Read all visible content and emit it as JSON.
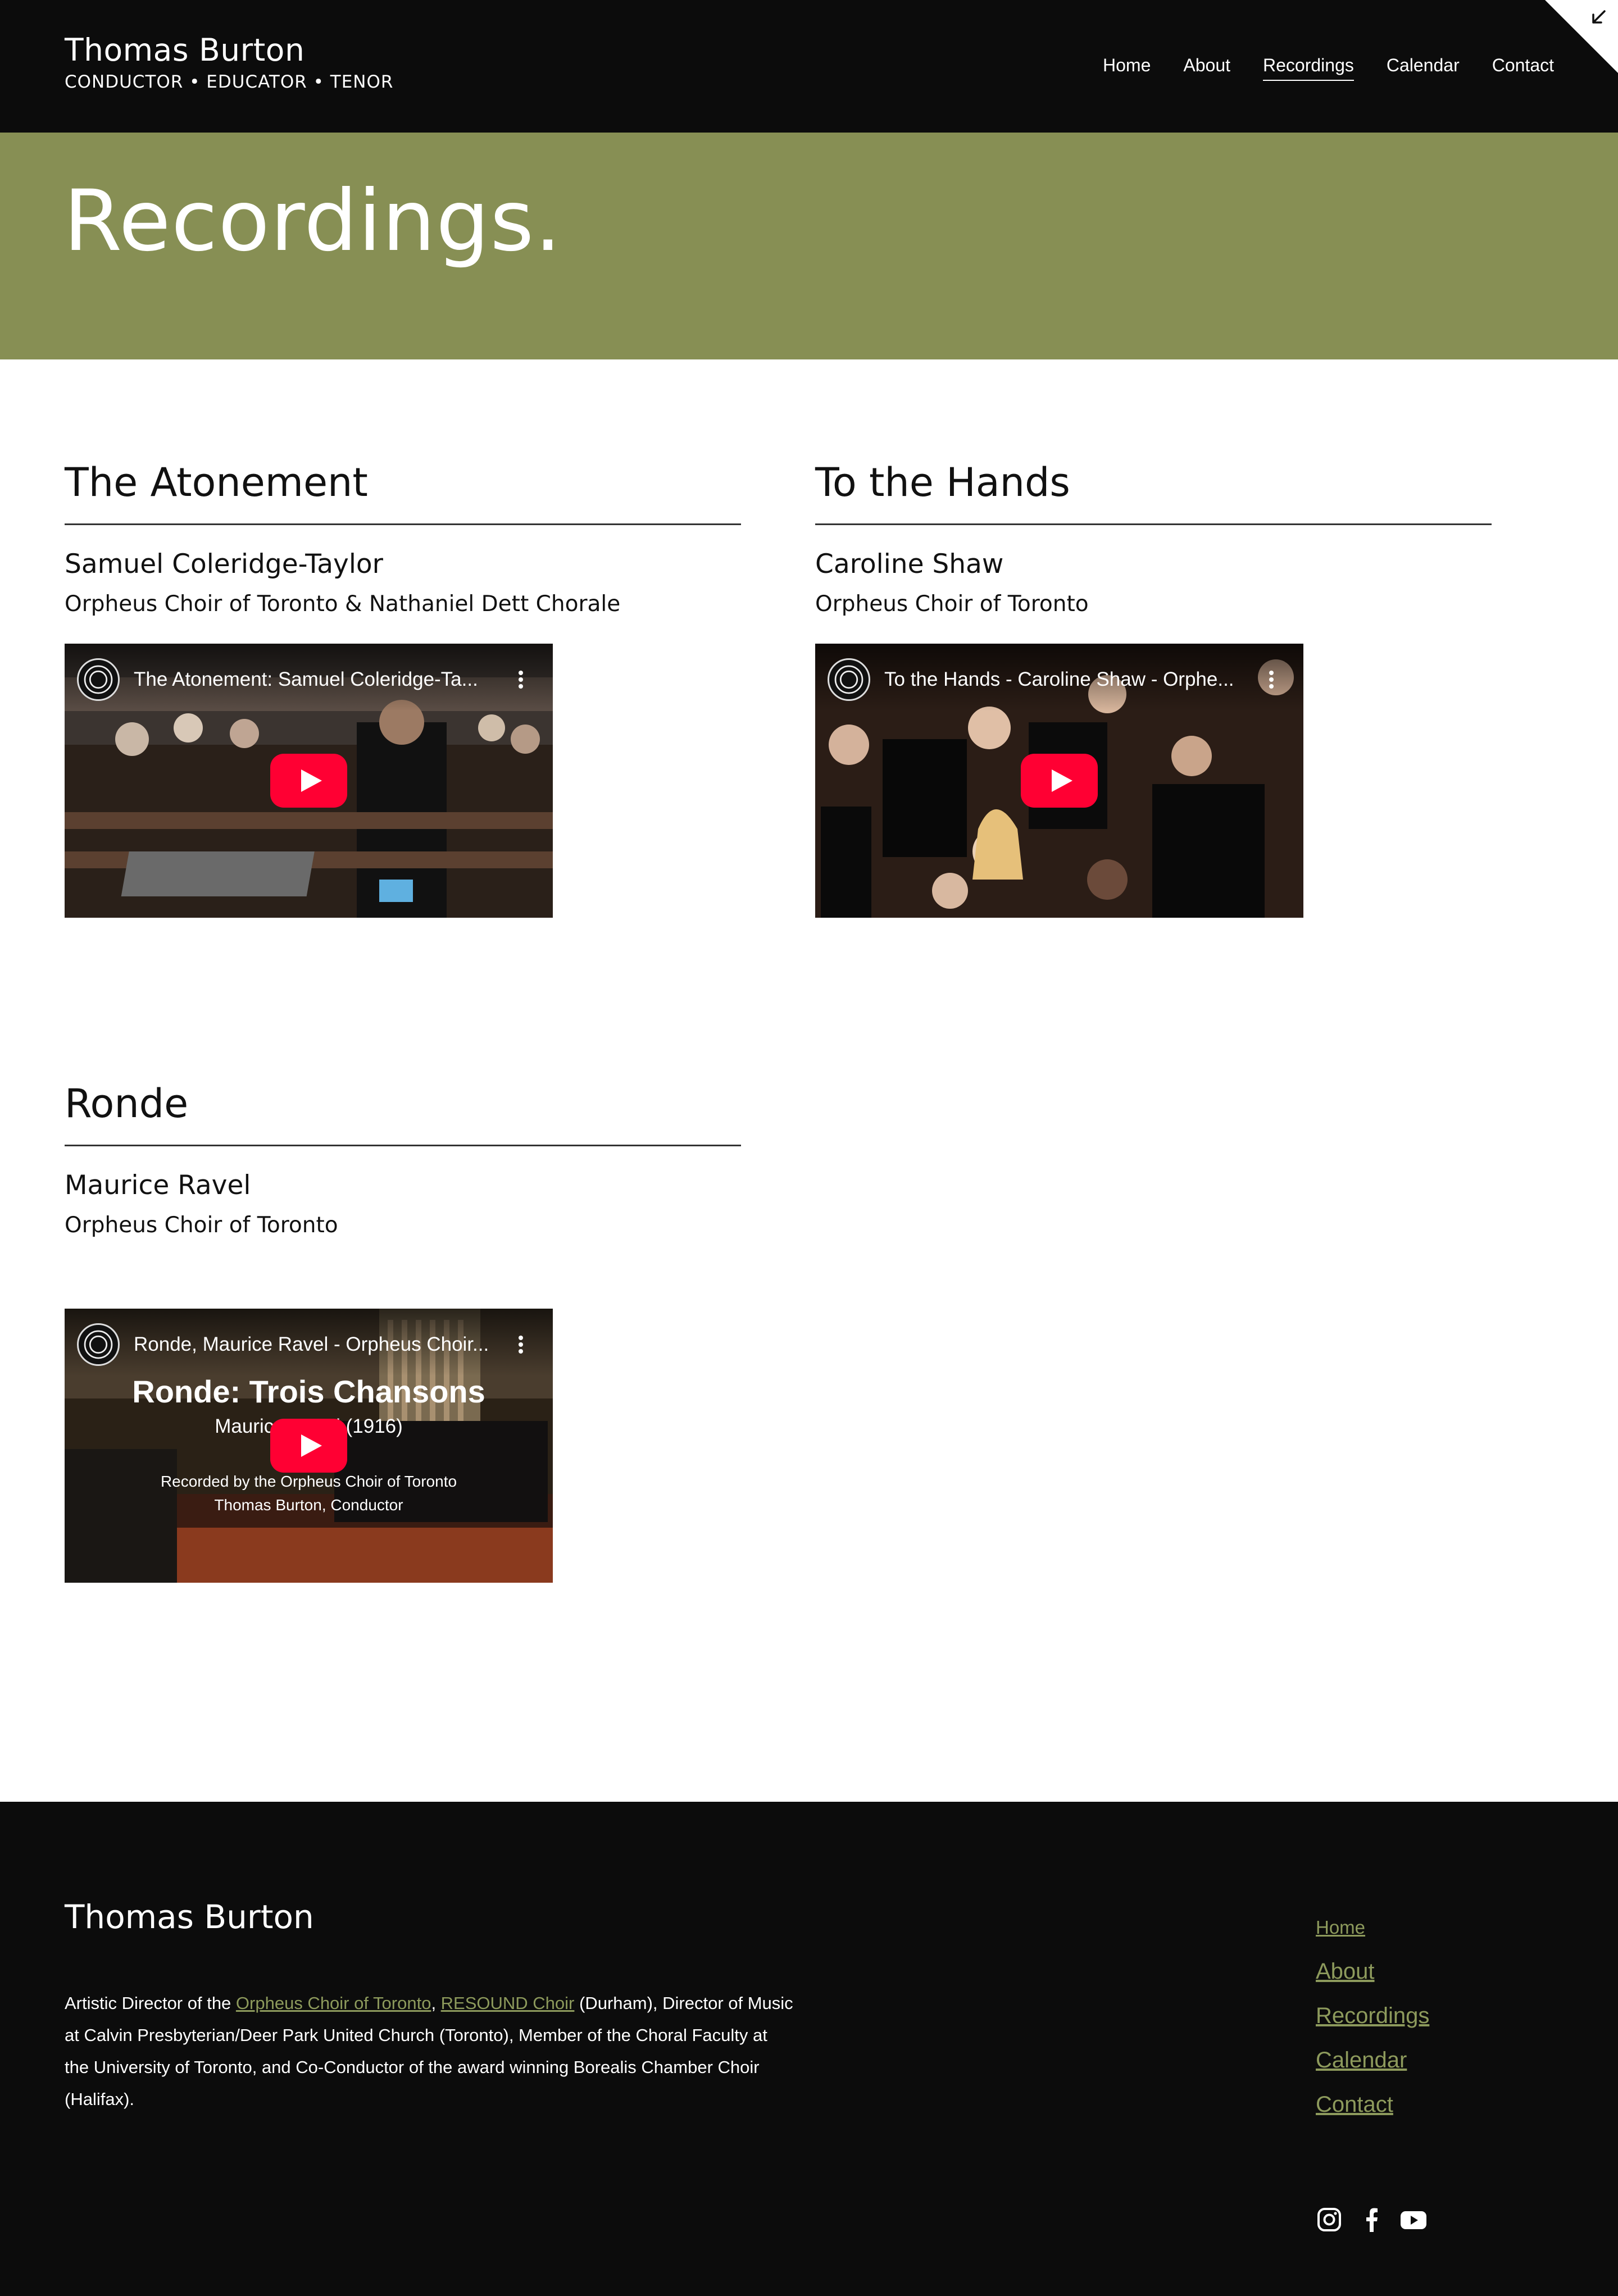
{
  "header": {
    "name": "Thomas Burton",
    "tagline": "CONDUCTOR • EDUCATOR • TENOR",
    "nav": [
      "Home",
      "About",
      "Recordings",
      "Calendar",
      "Contact"
    ],
    "active_nav": "Recordings"
  },
  "hero": {
    "title": "Recordings."
  },
  "recordings": [
    {
      "title": "The Atonement",
      "composer": "Samuel Coleridge-Taylor",
      "ensemble": "Orpheus Choir of Toronto & Nathaniel Dett Chorale",
      "video_title": "The Atonement: Samuel Coleridge-Ta..."
    },
    {
      "title": "To the Hands",
      "composer": "Caroline Shaw",
      "ensemble": "Orpheus Choir of Toronto",
      "video_title": "To the Hands - Caroline Shaw - Orphe..."
    },
    {
      "title": "Ronde",
      "composer": "Maurice Ravel",
      "ensemble": "Orpheus Choir of Toronto",
      "video_title": "Ronde, Maurice Ravel - Orpheus Choir...",
      "overlay": {
        "heading": "Ronde: Trois Chansons",
        "sub": "Maurice Ravel (1916)",
        "line1": "Recorded by the Orpheus Choir of Toronto",
        "line2": "Thomas Burton, Conductor"
      }
    }
  ],
  "footer": {
    "name": "Thomas Burton",
    "bio": {
      "pre": "Artistic Director of the ",
      "link1": "Orpheus Choir of Toronto",
      "sep": ", ",
      "link2": "RESOUND Choir",
      "post": " (Durham), Director of Music at Calvin Presbyterian/Deer Park United Church (Toronto), Member of the Choral Faculty at the University of Toronto, and Co-Conductor of the award winning Borealis Chamber Choir (Halifax)."
    },
    "nav": [
      "Home",
      "About",
      "Recordings",
      "Calendar",
      "Contact"
    ],
    "socials": [
      "instagram-icon",
      "facebook-icon",
      "youtube-icon"
    ]
  },
  "colors": {
    "header_bg": "#0c0c0c",
    "hero_bg": "#878f54",
    "footer_link": "#8d9a5c",
    "play_red": "#ff0033"
  }
}
